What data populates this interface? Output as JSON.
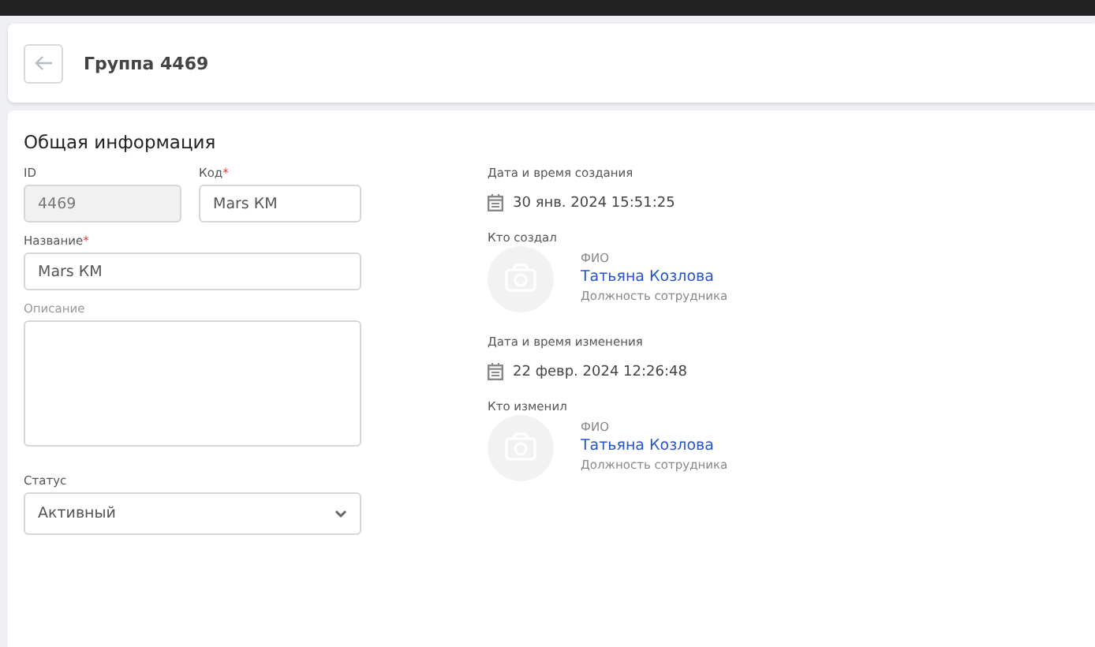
{
  "header": {
    "title": "Группа 4469"
  },
  "section": {
    "title": "Общая информация"
  },
  "fields": [
    {
      "label": "ID",
      "value": "4469",
      "disabled": true,
      "kind": "input"
    },
    {
      "label": "Код",
      "mark": "*",
      "value": "Mars КМ",
      "disabled": false,
      "kind": "input"
    },
    {
      "label": "Название",
      "mark": "*",
      "value": "Mars КМ",
      "disabled": false,
      "kind": "input"
    },
    {
      "label": "Описание",
      "disabled": false,
      "kind": "textarea"
    },
    {
      "label": "Статус",
      "value": "Активный",
      "disabled": false,
      "kind": "select"
    }
  ],
  "audit": [
    {
      "date_label": "Дата и время создания",
      "date": "30 янв. 2024 15:51:25",
      "who_label": "Кто создал",
      "fio_label": "ФИО",
      "name": "Татьяна Козлова",
      "position": "Должность сотрудника"
    },
    {
      "date_label": "Дата и время изменения",
      "date": "22 февр. 2024 12:26:48",
      "who_label": "Кто изменил",
      "fio_label": "ФИО",
      "name": "Татьяна Козлова",
      "position": "Должность сотрудника"
    }
  ]
}
